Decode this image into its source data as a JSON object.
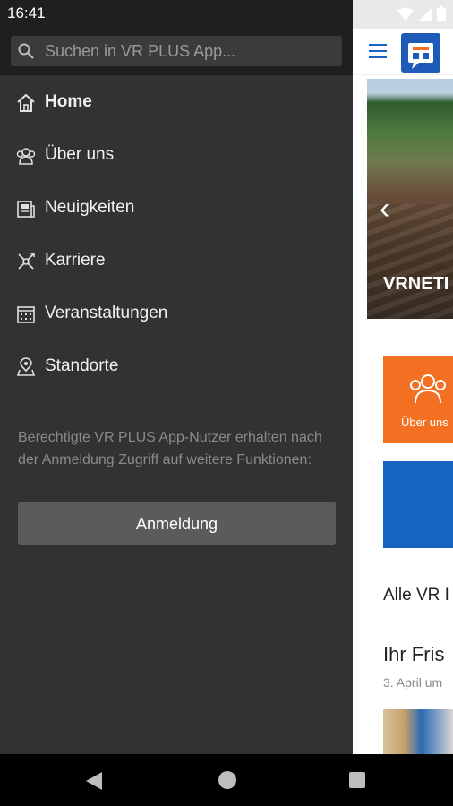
{
  "status": {
    "time": "16:41"
  },
  "search": {
    "placeholder": "Suchen in VR PLUS App..."
  },
  "nav": {
    "items": [
      {
        "label": "Home",
        "icon": "home-icon"
      },
      {
        "label": "Über uns",
        "icon": "people-icon"
      },
      {
        "label": "Neuigkeiten",
        "icon": "news-icon"
      },
      {
        "label": "Karriere",
        "icon": "career-icon"
      },
      {
        "label": "Veranstaltungen",
        "icon": "calendar-icon"
      },
      {
        "label": "Standorte",
        "icon": "location-icon"
      }
    ]
  },
  "info_text": "Berechtigte VR PLUS App-Nutzer erhalten nach der Anmeldung Zugriff auf weitere Funktionen:",
  "login_label": "Anmeldung",
  "app": {
    "hero_title": "VRNETI",
    "tile_label": "Über uns",
    "section_title": "Alle VR I",
    "article_title": "Ihr Fris",
    "article_date": "3. April um"
  },
  "colors": {
    "drawer": "#323232",
    "accent_orange": "#f36f21",
    "accent_blue": "#1565c0"
  }
}
